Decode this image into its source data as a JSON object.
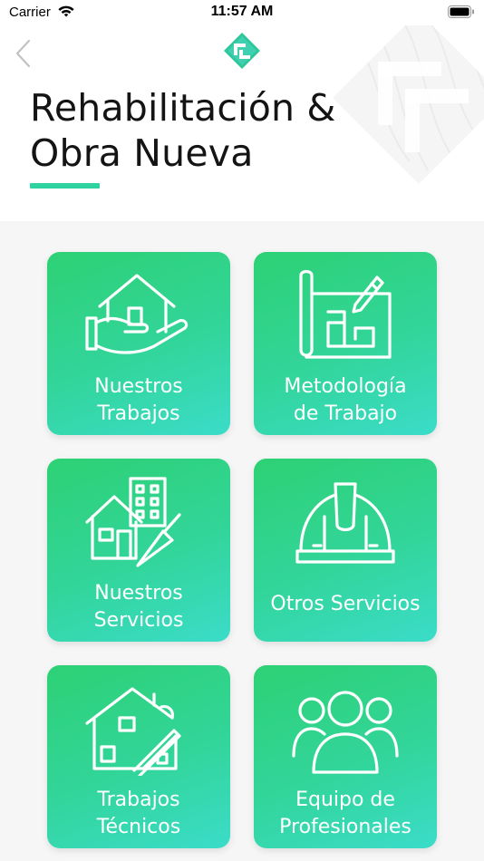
{
  "status_bar": {
    "carrier": "Carrier",
    "time": "11:57 AM"
  },
  "header": {
    "title_line1": "Rehabilitación &",
    "title_line2": "Obra Nueva",
    "accent_color": "#2fd3a0"
  },
  "tiles": [
    {
      "label": "Nuestros\nTrabajos",
      "icon": "house-in-hand-icon"
    },
    {
      "label": "Metodología\nde Trabajo",
      "icon": "blueprint-icon"
    },
    {
      "label": "Nuestros\nServicios",
      "icon": "construction-services-icon"
    },
    {
      "label": "Otros Servicios",
      "icon": "hard-hat-icon"
    },
    {
      "label": "Trabajos\nTécnicos",
      "icon": "technical-drawing-icon"
    },
    {
      "label": "Equipo de\nProfesionales",
      "icon": "team-icon"
    }
  ],
  "colors": {
    "tile_gradient_start": "#2dd174",
    "tile_gradient_end": "#3bdcc9",
    "background": "#f6f6f6"
  }
}
